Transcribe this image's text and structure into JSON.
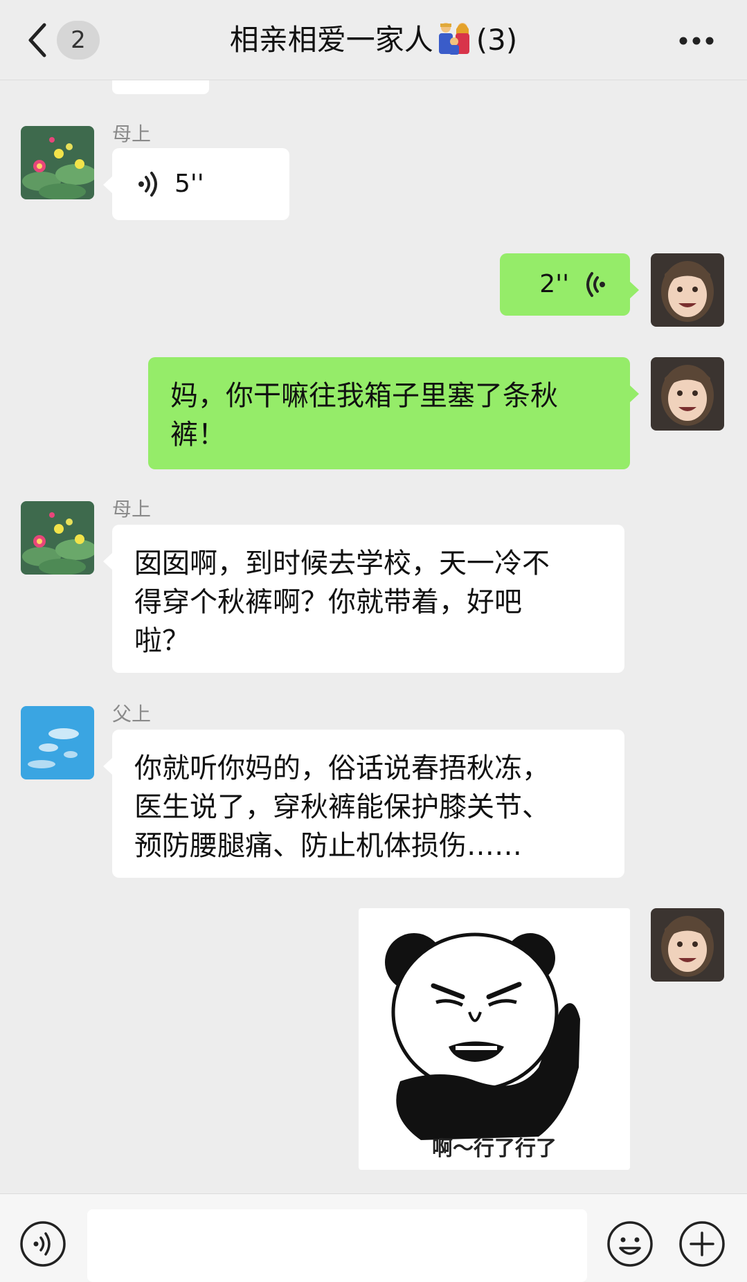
{
  "header": {
    "unread_count": "2",
    "title_prefix": "相亲相爱一家人",
    "title_suffix": "(3)",
    "title_emoji": "family-emoji"
  },
  "messages": [
    {
      "id": "m1",
      "sender": "母上",
      "side": "left",
      "type": "voice",
      "duration": "5''"
    },
    {
      "id": "m2",
      "sender": "me",
      "side": "right",
      "type": "voice",
      "duration": "2''"
    },
    {
      "id": "m3",
      "sender": "me",
      "side": "right",
      "type": "text",
      "text_lines": [
        "妈，你干嘛往我箱子里塞了条秋",
        "裤！"
      ]
    },
    {
      "id": "m4",
      "sender": "母上",
      "side": "left",
      "type": "text",
      "text_lines": [
        "囡囡啊，到时候去学校，天一冷不",
        "得穿个秋裤啊？你就带着，好吧",
        "啦？"
      ]
    },
    {
      "id": "m5",
      "sender": "父上",
      "side": "left",
      "type": "text",
      "text_lines": [
        "你就听你妈的，俗话说春捂秋冻，",
        "医生说了，穿秋裤能保护膝关节、",
        "预防腰腿痛、防止机体损伤……"
      ]
    },
    {
      "id": "m6",
      "sender": "me",
      "side": "right",
      "type": "sticker",
      "sticker_caption": "啊～行了行了"
    }
  ],
  "input": {
    "placeholder": "",
    "value": ""
  },
  "colors": {
    "background": "#ededed",
    "my_bubble": "#95ec69",
    "their_bubble": "#ffffff",
    "name_text": "#8a8a8a"
  },
  "icons": [
    "back-chevron-icon",
    "more-icon",
    "voice-icon",
    "emoji-icon",
    "plus-icon"
  ]
}
